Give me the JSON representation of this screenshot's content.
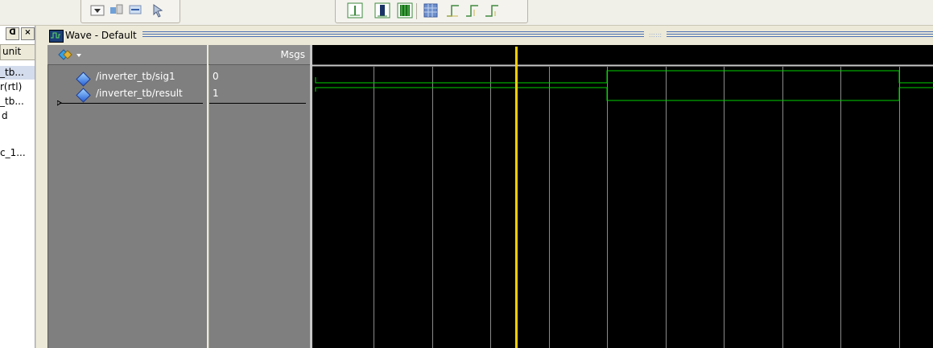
{
  "wave_window": {
    "title": "Wave - Default",
    "grip": "::::::",
    "value_header": "Msgs"
  },
  "left_pane": {
    "header": "unit",
    "dock_symbol": "ᗡ",
    "close_symbol": "×",
    "rows": [
      "_tb...",
      "r(rtl)",
      "_tb...",
      "d",
      "",
      "c_1..."
    ]
  },
  "signals": [
    {
      "name": "/inverter_tb/sig1",
      "value": "0"
    },
    {
      "name": "/inverter_tb/result",
      "value": "1"
    }
  ],
  "colors": {
    "cursor": "#ffcc00",
    "trace": "#00d000",
    "grid": "#8a8a8a",
    "wave_bg": "#000000"
  },
  "icons": {
    "toolbar": [
      "dropdown-arrow-icon",
      "zoom-full-icon",
      "zoom-in-out-icon",
      "pointer-icon",
      "insert-cursor-icon",
      "delete-cursor-icon",
      "waveform-icon",
      "grid-icon",
      "step-icon",
      "step-alt-icon",
      "edge-icon"
    ],
    "name_header": "add-wave-icon"
  }
}
